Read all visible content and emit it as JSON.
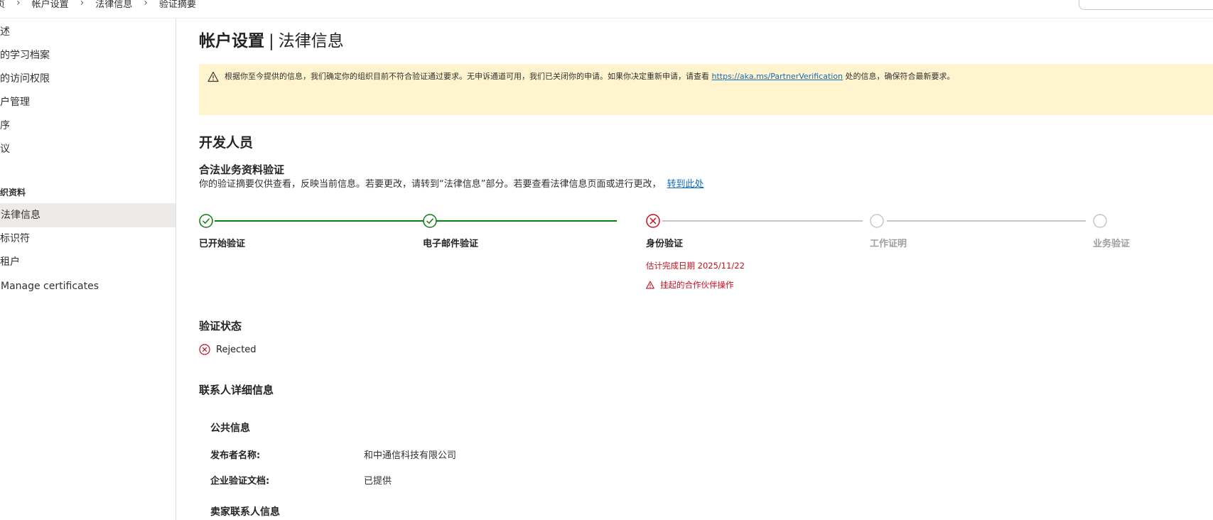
{
  "breadcrumb": [
    "页",
    "帐户设置",
    "法律信息",
    "验证摘要"
  ],
  "sidebar": {
    "items_top": [
      "述",
      "的学习档案",
      "的访问权限",
      "户管理",
      "序",
      "议"
    ],
    "section": "织资料",
    "items_bottom": [
      "法律信息",
      "标识符",
      "租户",
      "Manage certificates"
    ],
    "active_index": 0
  },
  "page": {
    "title_main": "帐户设置",
    "title_sep": "|",
    "title_sub": "法律信息"
  },
  "alert": {
    "text_before": "根据你至今提供的信息，我们确定你的组织目前不符合验证通过要求。无申诉通道可用，我们已关闭你的申请。如果你决定重新申请，请查看",
    "link": "https://aka.ms/PartnerVerification",
    "text_after": "处的信息，确保符合最新要求。"
  },
  "developer": {
    "heading": "开发人员",
    "verification_heading": "合法业务资料验证",
    "description": "你的验证摘要仅供查看，反映当前信息。若要更改，请转到“法律信息”部分。若要查看法律信息页面或进行更改，",
    "goto_link": "转到此处"
  },
  "steps": [
    {
      "label": "已开始验证",
      "state": "done"
    },
    {
      "label": "电子邮件验证",
      "state": "done"
    },
    {
      "label": "身份验证",
      "state": "failed"
    },
    {
      "label": "工作证明",
      "state": "pending"
    },
    {
      "label": "业务验证",
      "state": "pending"
    }
  ],
  "identity_step": {
    "estimate": "估计完成日期 2025/11/22",
    "pending_action": "挂起的合作伙伴操作"
  },
  "verification_status": {
    "heading": "验证状态",
    "value": "Rejected"
  },
  "contact": {
    "heading": "联系人详细信息",
    "public_heading": "公共信息",
    "publisher_label": "发布者名称:",
    "publisher_value": "和中通信科技有限公司",
    "docs_label": "企业验证文档:",
    "docs_value": "已提供",
    "seller_heading": "卖家联系人信息"
  },
  "colors": {
    "success": "#107c10",
    "error": "#c50f1f",
    "neutral": "#c8c6c4",
    "warning_bg": "#fff4ce",
    "link": "#0f6cbd"
  }
}
